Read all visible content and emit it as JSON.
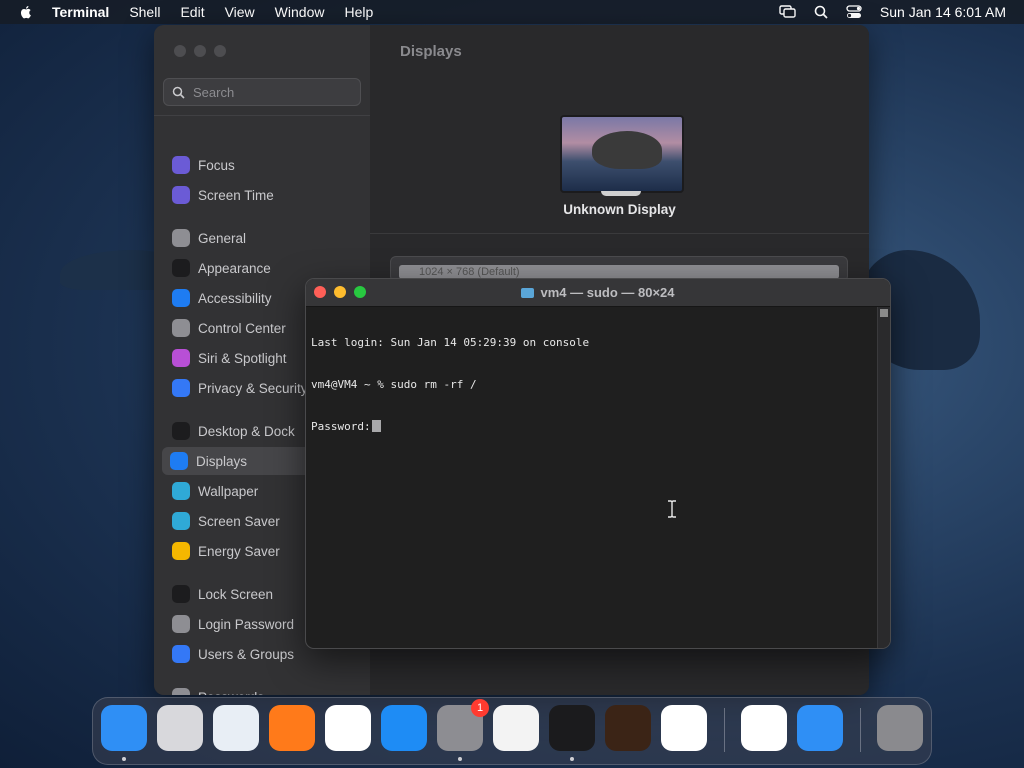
{
  "menubar": {
    "app": "Terminal",
    "items": [
      "Shell",
      "Edit",
      "View",
      "Window",
      "Help"
    ],
    "clock": "Sun Jan 14  6:01 AM"
  },
  "settings": {
    "search_placeholder": "Search",
    "content_title": "Displays",
    "display_name": "Unknown Display",
    "resolution": "1024 × 768 (Default)",
    "sidebar": [
      {
        "label": "Focus",
        "icon": "moon-icon",
        "color": "#6b5bd6"
      },
      {
        "label": "Screen Time",
        "icon": "hourglass-icon",
        "color": "#6b5bd6"
      },
      {
        "label": "General",
        "icon": "gear-icon",
        "color": "#8e8e93"
      },
      {
        "label": "Appearance",
        "icon": "appearance-icon",
        "color": "#1c1c1e"
      },
      {
        "label": "Accessibility",
        "icon": "accessibility-icon",
        "color": "#1e7cf2"
      },
      {
        "label": "Control Center",
        "icon": "control-center-icon",
        "color": "#8e8e93"
      },
      {
        "label": "Siri & Spotlight",
        "icon": "siri-icon",
        "color": "#b84fd6"
      },
      {
        "label": "Privacy & Security",
        "icon": "hand-icon",
        "color": "#3478f6"
      },
      {
        "label": "Desktop & Dock",
        "icon": "desktop-icon",
        "color": "#1c1c1e"
      },
      {
        "label": "Displays",
        "icon": "displays-icon",
        "color": "#1e7cf2"
      },
      {
        "label": "Wallpaper",
        "icon": "wallpaper-icon",
        "color": "#2fa9d6"
      },
      {
        "label": "Screen Saver",
        "icon": "screensaver-icon",
        "color": "#2fa9d6"
      },
      {
        "label": "Energy Saver",
        "icon": "energy-icon",
        "color": "#f5b700"
      },
      {
        "label": "Lock Screen",
        "icon": "lock-icon",
        "color": "#1c1c1e"
      },
      {
        "label": "Login Password",
        "icon": "login-password-icon",
        "color": "#8e8e93"
      },
      {
        "label": "Users & Groups",
        "icon": "users-icon",
        "color": "#3478f6"
      },
      {
        "label": "Passwords",
        "icon": "key-icon",
        "color": "#8e8e93"
      }
    ]
  },
  "terminal": {
    "title": "vm4 — sudo — 80×24",
    "lines": [
      "Last login: Sun Jan 14 05:29:39 on console",
      "vm4@VM4 ~ % sudo rm -rf /",
      "Password:"
    ]
  },
  "dock": {
    "apps": [
      {
        "name": "Finder",
        "icon": "finder-icon",
        "color": "#2f8ff5"
      },
      {
        "name": "Launchpad",
        "icon": "launchpad-icon",
        "color": "#d8d8dc"
      },
      {
        "name": "Safari",
        "icon": "safari-icon",
        "color": "#e8eef5"
      },
      {
        "name": "Firefox",
        "icon": "firefox-icon",
        "color": "#ff7a1a"
      },
      {
        "name": "Chrome",
        "icon": "chrome-icon",
        "color": "#ffffff"
      },
      {
        "name": "App Store",
        "icon": "app-store-icon",
        "color": "#1e8cf5"
      },
      {
        "name": "System Settings",
        "icon": "system-settings-icon",
        "color": "#8d8d92",
        "badge": "1"
      },
      {
        "name": "TextEdit",
        "icon": "textedit-icon",
        "color": "#f3f3f3"
      },
      {
        "name": "Terminal",
        "icon": "terminal-icon",
        "color": "#1b1b1d"
      },
      {
        "name": "GarageBand",
        "icon": "garageband-icon",
        "color": "#3b2416"
      },
      {
        "name": "Visual Studio Code",
        "icon": "vscode-icon",
        "color": "#ffffff"
      },
      {
        "name": "Visual Studio",
        "icon": "visual-studio-icon",
        "color": "#ffffff"
      },
      {
        "name": "Weather",
        "icon": "weather-icon",
        "color": "#2f8ff5"
      },
      {
        "name": "Trash",
        "icon": "trash-icon",
        "color": "#8a8a8e"
      }
    ]
  }
}
